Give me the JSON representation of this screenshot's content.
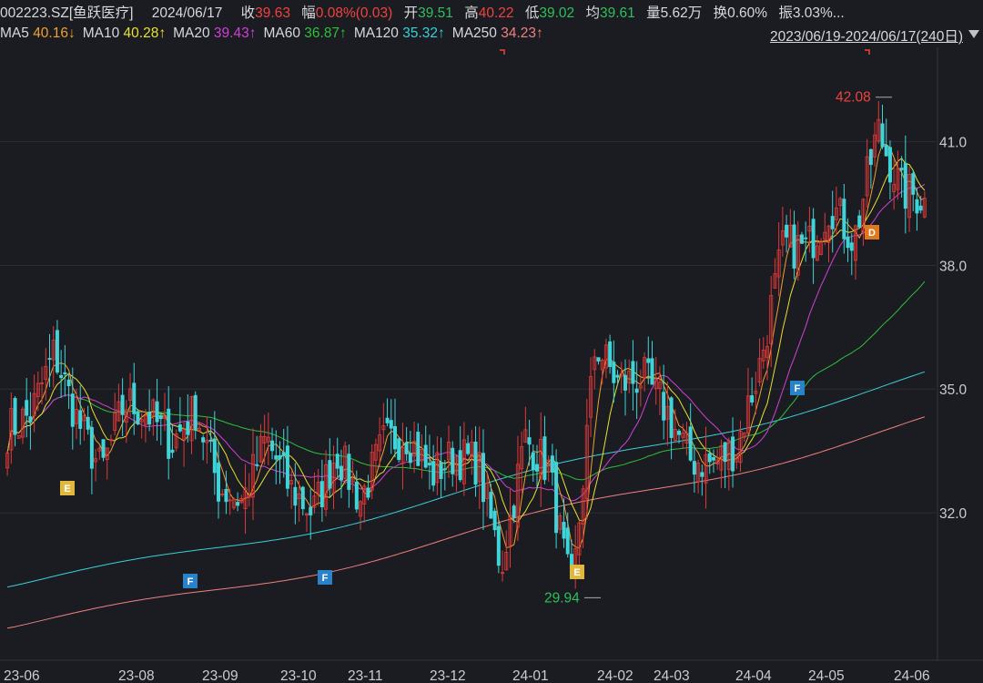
{
  "header": {
    "code": "002223.SZ[鱼跃医疗]",
    "date": "2024/06/17",
    "close_label": "收",
    "close_value": "39.63",
    "change_label": "幅",
    "change_value": "0.08%(0.03)",
    "open_label": "开",
    "open_value": "39.51",
    "high_label": "高",
    "high_value": "40.22",
    "low_label": "低",
    "low_value": "39.02",
    "avg_label": "均",
    "avg_value": "39.61",
    "volume_label": "量",
    "volume_value": "5.62万",
    "turnover_label": "换",
    "turnover_value": "0.60%",
    "amplitude_label": "振",
    "amplitude_value": "3.03%..."
  },
  "ma_legend": [
    {
      "label": "MA5",
      "value": "40.16↓",
      "color": "#f0a030"
    },
    {
      "label": "MA10",
      "value": "40.28↑",
      "color": "#e8e030"
    },
    {
      "label": "MA20",
      "value": "39.43↑",
      "color": "#d040d8"
    },
    {
      "label": "MA60",
      "value": "36.87↑",
      "color": "#2fbf3a"
    },
    {
      "label": "MA120",
      "value": "35.32↑",
      "color": "#3ad0d8"
    },
    {
      "label": "MA250",
      "value": "34.23↑",
      "color": "#f08080"
    }
  ],
  "range_label": "2023/06/19-2024/06/17(240日)",
  "colors": {
    "up": "#e0393a",
    "down": "#3fd4d8",
    "background": "#1b1c21",
    "grid": "#2c2e35"
  },
  "chart_data": {
    "type": "candlestick",
    "x_ticks": [
      "23-06",
      "23-08",
      "23-09",
      "23-10",
      "23-11",
      "23-12",
      "24-01",
      "24-02",
      "24-03",
      "24-04",
      "24-05",
      "24-06"
    ],
    "y_ticks": [
      "41.0",
      "38.0",
      "35.0",
      "32.0"
    ],
    "ylim": [
      28.6,
      43.2
    ],
    "high_annotation": "42.08",
    "low_annotation": "29.94",
    "markers": [
      "E",
      "F",
      "F",
      "E",
      "F",
      "D"
    ],
    "anchors": [
      34.0,
      34.4,
      35.9,
      34.2,
      33.0,
      34.7,
      34.4,
      33.7,
      34.5,
      32.6,
      32.3,
      33.8,
      32.6,
      32.0,
      33.5,
      32.3,
      33.7,
      33.9,
      32.9,
      33.4,
      33.2,
      30.7,
      33.8,
      33.1,
      29.9,
      36.1,
      35.1,
      35.3,
      34.5,
      33.3,
      33.2,
      33.6,
      35.6,
      38.5,
      38.4,
      39.5,
      38.6,
      41.3,
      39.8,
      39.63
    ],
    "ma_targets": {
      "MA5": 40.16,
      "MA10": 40.28,
      "MA20": 39.43,
      "MA60": 36.87,
      "MA120": 35.32,
      "MA250": 34.23
    },
    "ma_start": {
      "MA60": 31.0,
      "MA120": 30.2,
      "MA250": 29.2
    }
  }
}
